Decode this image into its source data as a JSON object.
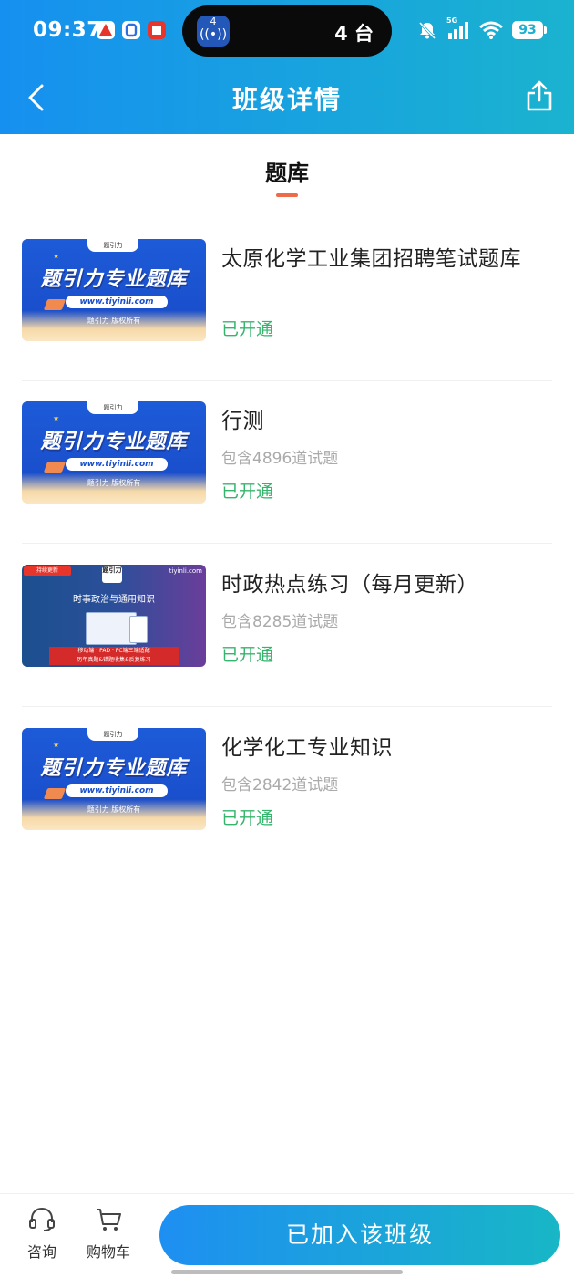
{
  "status_bar": {
    "time": "09:37",
    "island_count": "4 台",
    "island_badge": "4",
    "network": "5G",
    "battery": "93"
  },
  "nav": {
    "title": "班级详情"
  },
  "section": {
    "tab_label": "题库"
  },
  "thumb_text": {
    "brand": "题引力",
    "headline": "题引力专业题库",
    "url": "www.tiyinli.com",
    "rights": "题引力 版权所有",
    "p_tag": "持续更新",
    "p_site": "tiyinli.com",
    "p_logo": "题引力",
    "p_headline": "时事政治与通用知识",
    "p_banner_1": "移动端 · PAD · PC端三端适配",
    "p_banner_2": "历年真题&错题收集&反复练习"
  },
  "items": [
    {
      "title": "太原化学工业集团招聘笔试题库",
      "count": "",
      "status": "已开通"
    },
    {
      "title": "行测",
      "count": "包含4896道试题",
      "status": "已开通"
    },
    {
      "title": "时政热点练习（每月更新）",
      "count": "包含8285道试题",
      "status": "已开通"
    },
    {
      "title": "化学化工专业知识",
      "count": "包含2842道试题",
      "status": "已开通"
    }
  ],
  "bottom": {
    "consult_label": "咨询",
    "cart_label": "购物车",
    "join_label": "已加入该班级"
  },
  "colors": {
    "header_start": "#1690f0",
    "header_end": "#1ab3cf",
    "status_green": "#35b56c",
    "tab_underline": "#ee6a48"
  }
}
